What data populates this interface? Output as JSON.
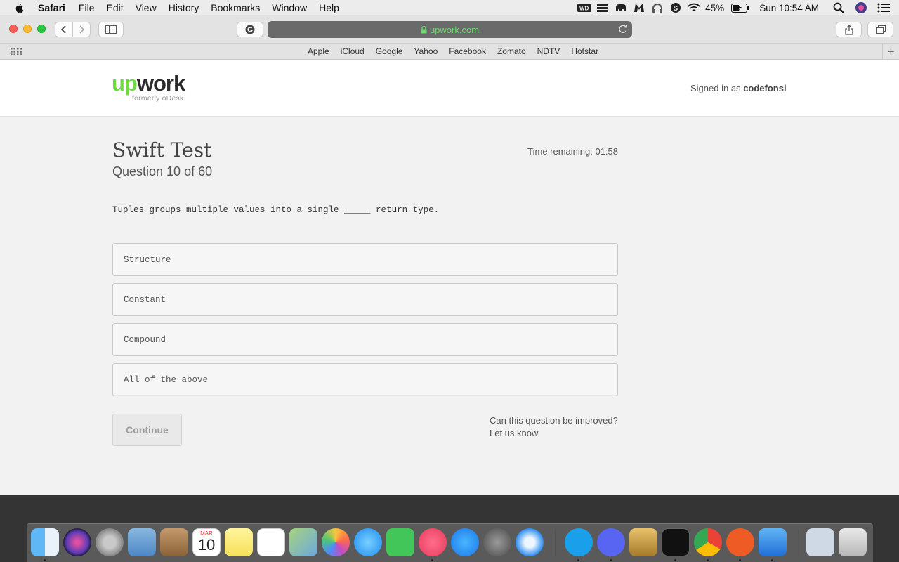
{
  "menubar": {
    "app": "Safari",
    "items": [
      "File",
      "Edit",
      "View",
      "History",
      "Bookmarks",
      "Window",
      "Help"
    ],
    "battery": "45%",
    "clock": "Sun 10:54 AM"
  },
  "browser": {
    "url": "upwork.com",
    "favorites": [
      "Apple",
      "iCloud",
      "Google",
      "Yahoo",
      "Facebook",
      "Zomato",
      "NDTV",
      "Hotstar"
    ]
  },
  "header": {
    "logo_up": "up",
    "logo_work": "work",
    "logo_sub": "formerly oDesk",
    "signed_prefix": "Signed in as",
    "username": "codefonsi"
  },
  "test": {
    "title": "Swift Test",
    "question_number": "Question 10 of 60",
    "time_remaining": "Time remaining: 01:58",
    "question": "Tuples groups multiple values into a single _____ return type.",
    "options": [
      "Structure",
      "Constant",
      "Compound",
      "All of the above"
    ],
    "continue_label": "Continue",
    "improve_question": "Can this question be improved?",
    "improve_link": "Let us know"
  },
  "colors": {
    "upwork_green": "#6fda44",
    "url_text": "#6fd66f",
    "page_bg": "#f2f2f2"
  },
  "dock": {
    "apps": [
      "finder-icon",
      "siri-icon",
      "launchpad-icon",
      "mail-icon",
      "contacts-icon",
      "calendar-icon",
      "notes-icon",
      "reminders-icon",
      "maps-icon",
      "photos-icon",
      "messages-icon",
      "facetime-icon",
      "itunes-icon",
      "app-store-icon",
      "system-preferences-icon",
      "safari-icon",
      "skype-icon",
      "discord-icon",
      "keychain-icon",
      "terminal-icon",
      "chrome-icon",
      "postman-icon",
      "xcode-icon",
      "documents-icon",
      "trash-icon"
    ],
    "calendar_month": "MAR",
    "calendar_day": "10"
  }
}
